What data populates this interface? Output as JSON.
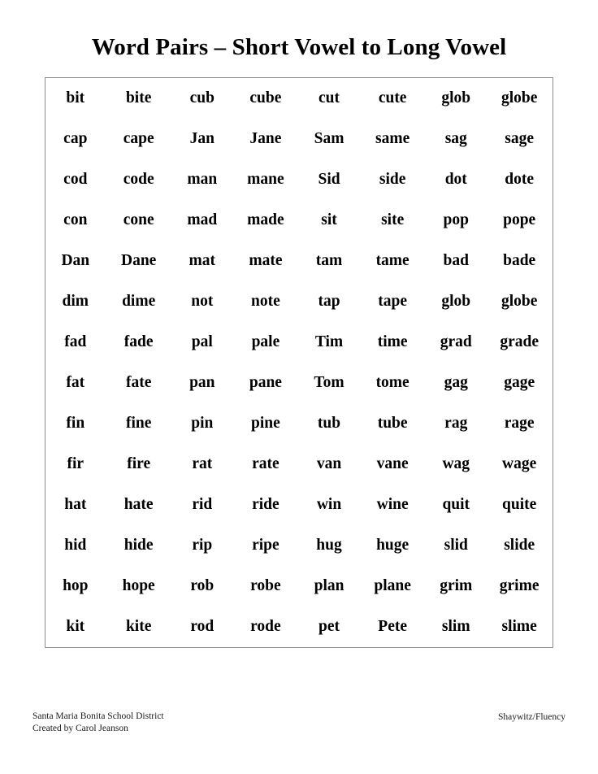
{
  "document": {
    "title": "Word Pairs – Short Vowel to Long Vowel"
  },
  "table": {
    "column_groups": [
      {
        "index": 0,
        "rows": [
          {
            "short": "bit",
            "long": "bite"
          },
          {
            "short": "cap",
            "long": "cape"
          },
          {
            "short": "cod",
            "long": "code"
          },
          {
            "short": "con",
            "long": "cone"
          },
          {
            "short": "Dan",
            "long": "Dane"
          },
          {
            "short": "dim",
            "long": "dime"
          },
          {
            "short": "fad",
            "long": "fade"
          },
          {
            "short": "fat",
            "long": "fate"
          },
          {
            "short": "fin",
            "long": "fine"
          },
          {
            "short": "fir",
            "long": "fire"
          },
          {
            "short": "hat",
            "long": "hate"
          },
          {
            "short": "hid",
            "long": "hide"
          },
          {
            "short": "hop",
            "long": "hope"
          },
          {
            "short": "kit",
            "long": "kite"
          }
        ]
      },
      {
        "index": 1,
        "rows": [
          {
            "short": "cub",
            "long": "cube"
          },
          {
            "short": "Jan",
            "long": "Jane"
          },
          {
            "short": "man",
            "long": "mane"
          },
          {
            "short": "mad",
            "long": "made"
          },
          {
            "short": "mat",
            "long": "mate"
          },
          {
            "short": "not",
            "long": "note"
          },
          {
            "short": "pal",
            "long": "pale"
          },
          {
            "short": "pan",
            "long": "pane"
          },
          {
            "short": "pin",
            "long": "pine"
          },
          {
            "short": "rat",
            "long": "rate"
          },
          {
            "short": "rid",
            "long": "ride"
          },
          {
            "short": "rip",
            "long": "ripe"
          },
          {
            "short": "rob",
            "long": "robe"
          },
          {
            "short": "rod",
            "long": "rode"
          }
        ]
      },
      {
        "index": 2,
        "rows": [
          {
            "short": "cut",
            "long": "cute"
          },
          {
            "short": "Sam",
            "long": "same"
          },
          {
            "short": "Sid",
            "long": "side"
          },
          {
            "short": "sit",
            "long": "site"
          },
          {
            "short": "tam",
            "long": "tame"
          },
          {
            "short": "tap",
            "long": "tape"
          },
          {
            "short": "Tim",
            "long": "time"
          },
          {
            "short": "Tom",
            "long": "tome"
          },
          {
            "short": "tub",
            "long": "tube"
          },
          {
            "short": "van",
            "long": "vane"
          },
          {
            "short": "win",
            "long": "wine"
          },
          {
            "short": "hug",
            "long": "huge"
          },
          {
            "short": "plan",
            "long": "plane"
          },
          {
            "short": "pet",
            "long": "Pete"
          }
        ]
      },
      {
        "index": 3,
        "rows": [
          {
            "short": "glob",
            "long": "globe"
          },
          {
            "short": "sag",
            "long": "sage"
          },
          {
            "short": "dot",
            "long": "dote"
          },
          {
            "short": "pop",
            "long": "pope"
          },
          {
            "short": "bad",
            "long": "bade"
          },
          {
            "short": "glob",
            "long": "globe"
          },
          {
            "short": "grad",
            "long": "grade"
          },
          {
            "short": "gag",
            "long": "gage"
          },
          {
            "short": "rag",
            "long": "rage"
          },
          {
            "short": "wag",
            "long": "wage"
          },
          {
            "short": "quit",
            "long": "quite"
          },
          {
            "short": "slid",
            "long": "slide"
          },
          {
            "short": "grim",
            "long": "grime"
          },
          {
            "short": "slim",
            "long": "slime"
          }
        ]
      }
    ]
  },
  "footer": {
    "left_line_1": "Santa Maria Bonita School District",
    "left_line_2": "Created by Carol Jeanson",
    "right": "Shaywitz/Fluency"
  },
  "colors": {
    "page_background": "#ffffff",
    "text": "#000000",
    "table_border": "#8b8b8b",
    "footer_text": "#1a1a1a"
  }
}
